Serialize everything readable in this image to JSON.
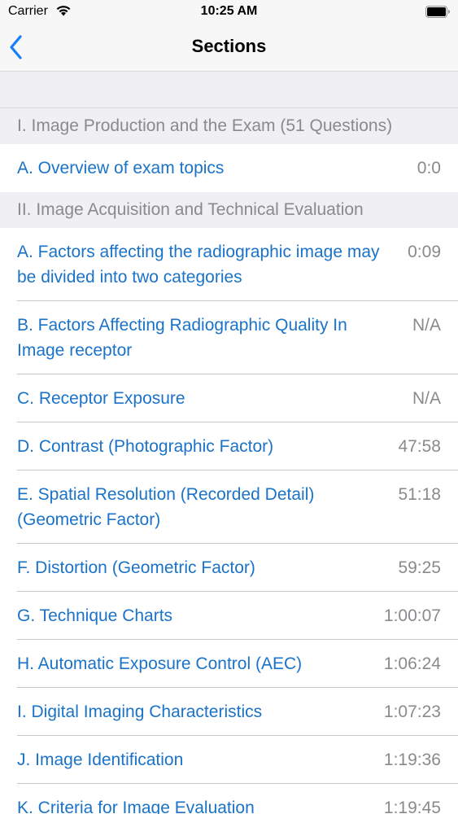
{
  "status_bar": {
    "carrier": "Carrier",
    "time": "10:25 AM"
  },
  "nav": {
    "title": "Sections",
    "back_icon": "chevron-left-icon"
  },
  "colors": {
    "link": "#1a73c8",
    "secondary_text": "#8a8a8e",
    "grouped_background": "#efeff4",
    "tint": "#147efb"
  },
  "sections": [
    {
      "header": "I. Image Production and the Exam (51 Questions)",
      "items": [
        {
          "title": "A. Overview of exam topics",
          "time": "0:0"
        }
      ]
    },
    {
      "header": "II. Image Acquisition and Technical Evaluation",
      "items": [
        {
          "title": "A. Factors affecting the radiographic image may be divided into two categories",
          "time": "0:09"
        },
        {
          "title": "B. Factors Affecting Radiographic Quality In Image receptor",
          "time": "N/A"
        },
        {
          "title": "C. Receptor Exposure",
          "time": "N/A"
        },
        {
          "title": "D. Contrast (Photographic Factor)",
          "time": "47:58"
        },
        {
          "title": "E. Spatial Resolution (Recorded Detail) (Geometric Factor)",
          "time": "51:18"
        },
        {
          "title": "F. Distortion (Geometric Factor)",
          "time": "59:25"
        },
        {
          "title": "G. Technique Charts",
          "time": "1:00:07"
        },
        {
          "title": "H. Automatic Exposure Control (AEC)",
          "time": "1:06:24"
        },
        {
          "title": "I. Digital Imaging Characteristics",
          "time": "1:07:23"
        },
        {
          "title": "J. Image Identification",
          "time": "1:19:36"
        },
        {
          "title": "K. Criteria for Image Evaluation",
          "time": "1:19:45"
        }
      ]
    }
  ]
}
